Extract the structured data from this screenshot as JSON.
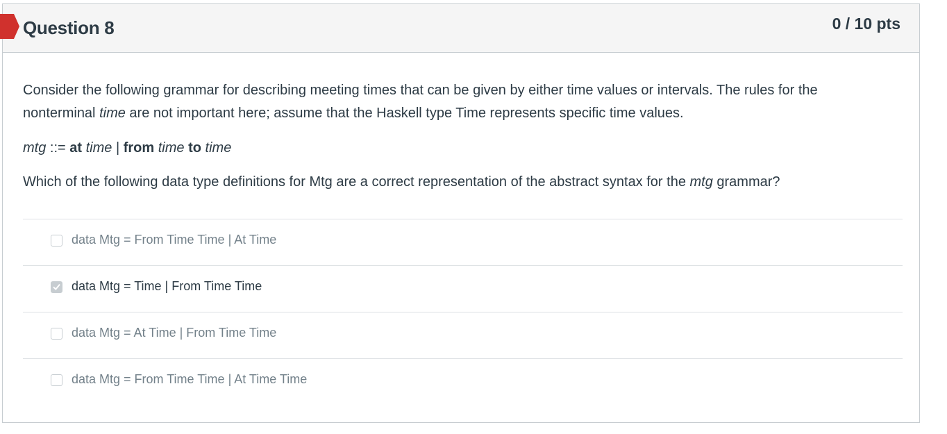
{
  "question": {
    "title": "Question 8",
    "points": "0 / 10 pts"
  },
  "body": {
    "intro_line1": "Consider the following grammar for describing meeting times that can be given by either time values or intervals. The rules for the",
    "intro_line2_a": "nonterminal ",
    "intro_line2_em": "time",
    "intro_line2_b": " are not important here; assume that the Haskell type Time represents specific time values.",
    "grammar": {
      "nt_mtg": "mtg",
      "def": " ::= ",
      "kw_at": "at",
      "nt_time1": "time",
      "bar": " | ",
      "kw_from": "from",
      "nt_time2": "time",
      "kw_to": "to",
      "nt_time3": "time"
    },
    "ask_a": "Which of the following data type definitions for Mtg are a correct representation of the abstract syntax for the ",
    "ask_em": "mtg",
    "ask_b": " grammar?"
  },
  "answers": [
    {
      "text": "data Mtg = From Time Time | At Time",
      "checked": false
    },
    {
      "text": "data Mtg = Time | From Time Time",
      "checked": true
    },
    {
      "text": "data Mtg = At Time | From Time Time",
      "checked": false
    },
    {
      "text": "data Mtg = From Time Time | At Time Time",
      "checked": false
    }
  ],
  "colors": {
    "flag": "#d0312d",
    "text": "#2d3b45",
    "muted_text": "#73818a",
    "header_bg": "#f5f5f5",
    "border": "#c7cdd1"
  },
  "icons": {
    "flag": "question-flag-icon",
    "check": "checkmark-icon"
  }
}
